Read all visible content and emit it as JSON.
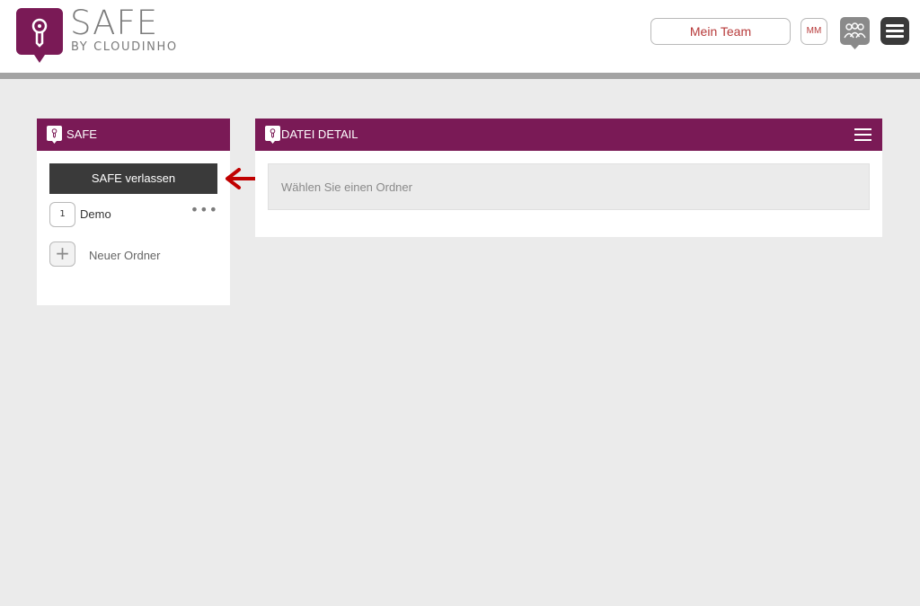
{
  "header": {
    "logo_title": "SAFE",
    "logo_subtitle": "BY CLOUDINHO",
    "team_button": "Mein Team",
    "user_initials": "MM",
    "icons": [
      "safe-logo-icon",
      "group-icon",
      "menu-icon"
    ]
  },
  "safe_panel": {
    "title": "SAFE",
    "leave_button": "SAFE verlassen",
    "folders": [
      {
        "badge": "1",
        "name": "Demo",
        "more": "•••"
      }
    ],
    "new_folder_icon": "+",
    "new_folder_label": "Neuer Ordner"
  },
  "detail_panel": {
    "title": "DATEI DETAIL",
    "placeholder": "Wählen Sie einen Ordner"
  },
  "colors": {
    "brand": "#7a1a56",
    "dark_button": "#3a3a3a",
    "accent_text": "#b73a3a",
    "arrow": "#c00000"
  }
}
